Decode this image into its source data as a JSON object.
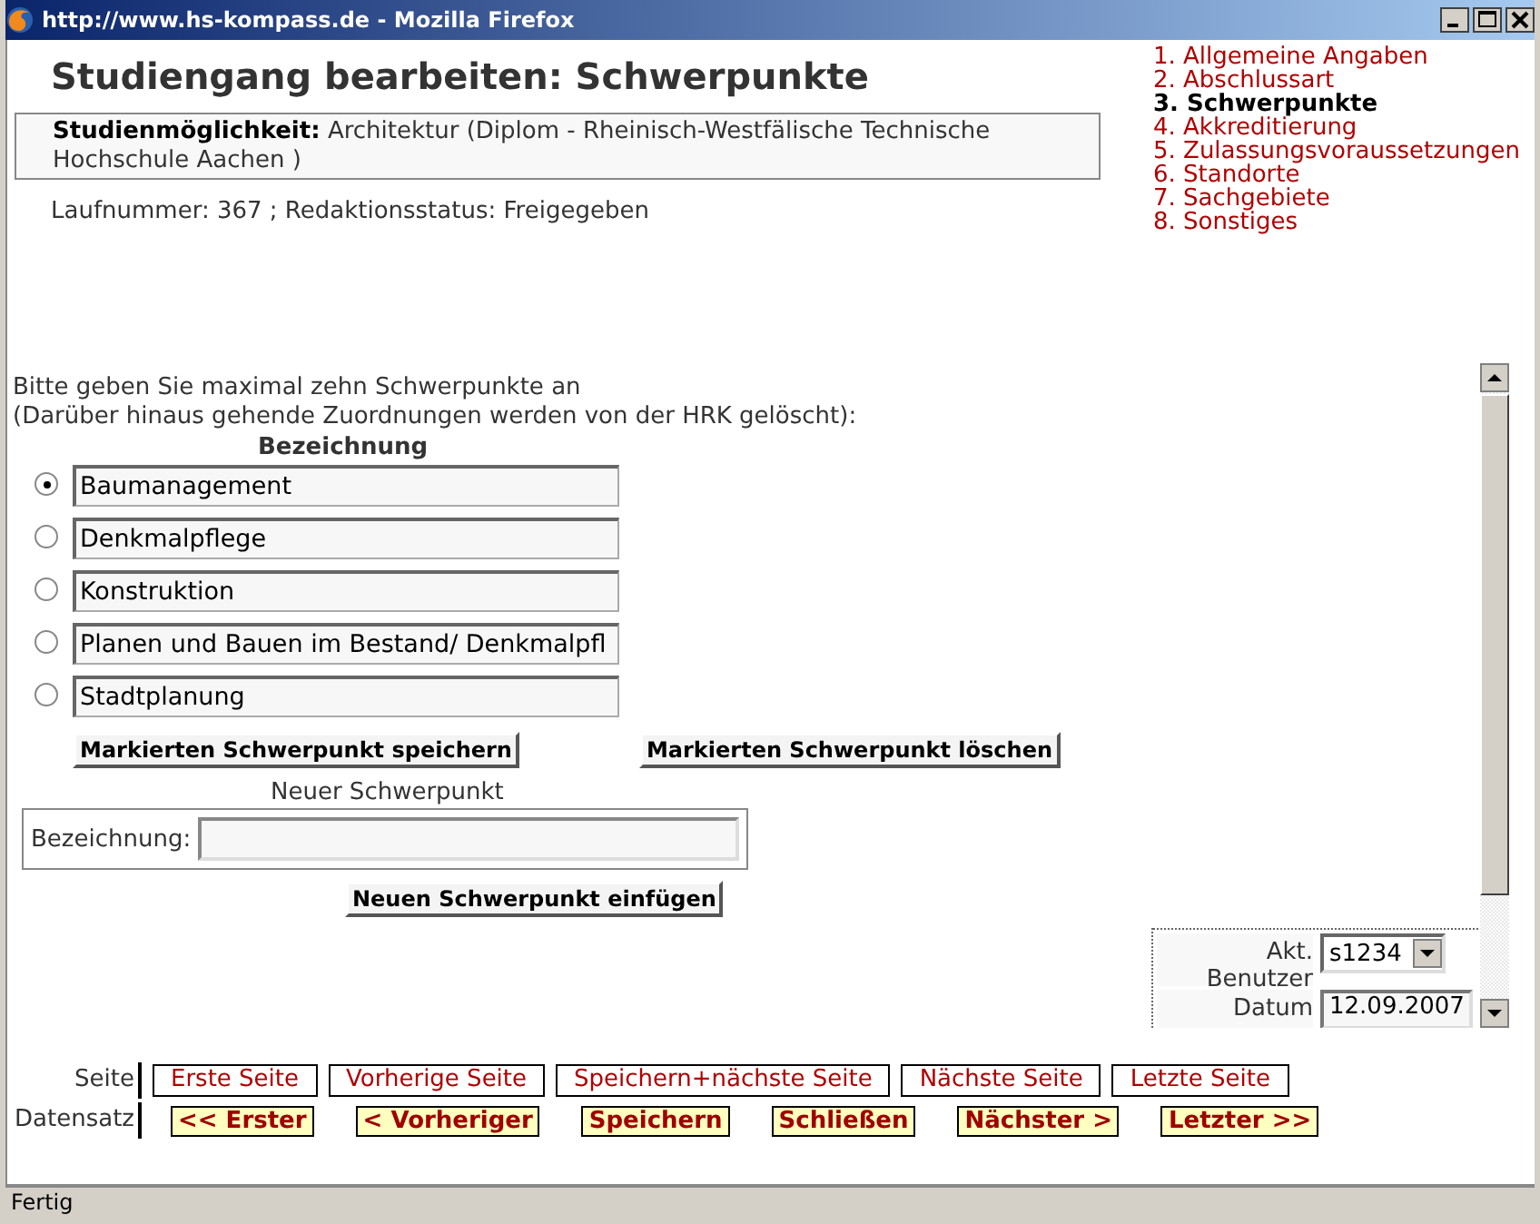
{
  "window": {
    "title": "http://www.hs-kompass.de - Mozilla Firefox"
  },
  "heading": "Studiengang bearbeiten: Schwerpunkte",
  "info": {
    "label": "Studienmöglichkeit:",
    "value": "Architektur (Diplom - Rheinisch-Westfälische Technische Hochschule Aachen )"
  },
  "status_line": "Laufnummer: 367 ; Redaktionsstatus: Freigegeben",
  "steps": [
    {
      "label": "1. Allgemeine Angaben",
      "selected": false
    },
    {
      "label": "2. Abschlussart",
      "selected": false
    },
    {
      "label": "3. Schwerpunkte",
      "selected": true
    },
    {
      "label": "4. Akkreditierung",
      "selected": false
    },
    {
      "label": "5. Zulassungsvoraussetzungen",
      "selected": false
    },
    {
      "label": "6. Standorte",
      "selected": false
    },
    {
      "label": "7. Sachgebiete",
      "selected": false
    },
    {
      "label": "8. Sonstiges",
      "selected": false
    }
  ],
  "form": {
    "intro": [
      "Bitte geben Sie maximal zehn Schwerpunkte an",
      "(Darüber hinaus gehende Zuordnungen werden von der HRK gelöscht):"
    ],
    "column_header": "Bezeichnung",
    "items": [
      {
        "value": "Baumanagement",
        "selected": true
      },
      {
        "value": "Denkmalpflege",
        "selected": false
      },
      {
        "value": "Konstruktion",
        "selected": false
      },
      {
        "value": "Planen und Bauen im Bestand/ Denkmalpfl",
        "selected": false
      },
      {
        "value": "Stadtplanung",
        "selected": false
      }
    ],
    "buttons": [
      "Markierten Schwerpunkt speichern",
      "Markierten Schwerpunkt löschen"
    ],
    "new_entry": {
      "title": "Neuer Schwerpunkt",
      "label": "Bezeichnung:",
      "button": "Neuen Schwerpunkt einfügen"
    },
    "meta": [
      {
        "label": "Akt. Benutzer",
        "value": "s1234",
        "kind": "select"
      },
      {
        "label": "Datum",
        "value": "12.09.2007",
        "kind": "input"
      }
    ]
  },
  "page_nav": {
    "label": "Seite",
    "links": [
      "Erste Seite",
      "Vorherige Seite",
      "Speichern+nächste Seite",
      "Nächste Seite",
      "Letzte Seite"
    ]
  },
  "record_nav": {
    "label": "Datensatz",
    "buttons": [
      "<< Erster",
      "< Vorheriger",
      "Speichern",
      "Schließen",
      "Nächster >",
      "Letzter >>"
    ]
  },
  "status_bar": "Fertig"
}
